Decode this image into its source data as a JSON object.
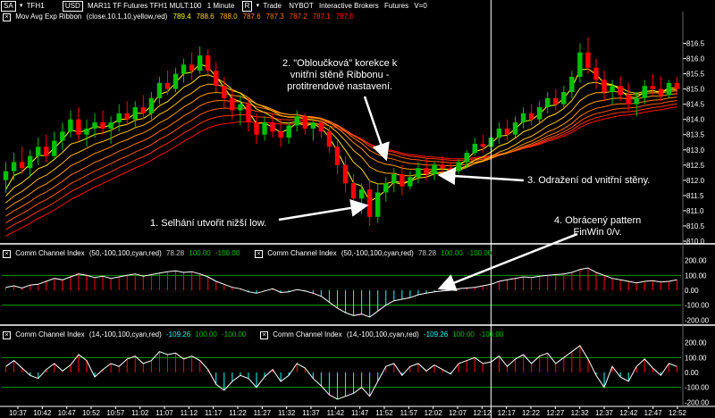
{
  "toolbar": {
    "symbol_box": "SA",
    "symbol": "TFH1",
    "instrument_box": "USD",
    "instrument": "MAR11 TF Futures TFH1 MULT:100",
    "interval": "1 Minute",
    "mode_box": "R",
    "trade": "Trade",
    "exchange": "NYBOT",
    "broker": "Interactive Brokers",
    "type": "Futures",
    "volume": "V=0"
  },
  "ribbon_legend": {
    "label": "Mov Avg Exp Ribbon",
    "params": "(close,10,1,10,yellow,red)",
    "values": [
      "789.4",
      "788.6",
      "788.0",
      "787.6",
      "787.3",
      "787.2",
      "787.1",
      "787.0"
    ],
    "colors": [
      "#ffff00",
      "#ffdd00",
      "#ffbb00",
      "#ff9900",
      "#ff7700",
      "#ff5500",
      "#ff3300",
      "#ff1100"
    ]
  },
  "cci1": {
    "label": "Comm Channel Index",
    "params": "(50,-100,100,cyan,red)",
    "value": "78.28",
    "upper": "100.00",
    "lower": "-100.00",
    "axis": [
      "200.00",
      "100.00",
      "0.00",
      "-100.00",
      "-200.00"
    ]
  },
  "cci2": {
    "label": "Comm Channel Index",
    "params": "(14,-100,100,cyan,red)",
    "value": "-109.26",
    "upper": "100.00",
    "lower": "-100.00",
    "axis": [
      "200.00",
      "100.00",
      "0.00",
      "-100.00",
      "-200.00"
    ]
  },
  "price_axis": [
    "816.5",
    "816.0",
    "815.5",
    "815.0",
    "814.5",
    "814.0",
    "813.5",
    "813.0",
    "812.5",
    "812.0",
    "811.5",
    "811.0",
    "810.5",
    "810.0"
  ],
  "time_axis": [
    "10:37",
    "10:42",
    "10:47",
    "10:52",
    "10:57",
    "11:02",
    "11:07",
    "11:12",
    "11:17",
    "11:22",
    "11:27",
    "11:32",
    "11:37",
    "11:42",
    "11:47",
    "11:52",
    "11:57",
    "12:02",
    "12:07",
    "12:12",
    "12:17",
    "12:22",
    "12:27",
    "12:32",
    "12:37",
    "12:42",
    "12:47",
    "12:52"
  ],
  "annotations": {
    "a1": "1. Selhání utvořit nižší low.",
    "a2": [
      "2. \"Obloučková\" korekce k",
      "vnitřní stěně Ribbonu -",
      "protitrendové nastavení."
    ],
    "a3": "3. Odražení od vnitřní stěny.",
    "a4": [
      "4. Obrácený pattern",
      "FinWin 0/v."
    ]
  },
  "colors": {
    "background": "#000000",
    "bull": "#00c000",
    "bear": "#ff0000",
    "cci_pos": "#ff0000",
    "cci_neg": "#00ffff",
    "level_line": "#00a000",
    "cursor": "#ffffff",
    "legend_value": "#00c000"
  },
  "chart_data": {
    "type": "candlestick",
    "ylim": [
      810.0,
      816.75
    ],
    "ohlc": [
      [
        812.0,
        812.6,
        811.6,
        812.3
      ],
      [
        812.3,
        812.9,
        812.0,
        812.6
      ],
      [
        812.6,
        813.1,
        812.2,
        812.4
      ],
      [
        812.4,
        813.0,
        812.1,
        812.8
      ],
      [
        812.8,
        813.4,
        812.5,
        813.1
      ],
      [
        813.1,
        813.5,
        812.6,
        812.8
      ],
      [
        812.8,
        813.6,
        812.7,
        813.3
      ],
      [
        813.3,
        813.9,
        813.0,
        813.6
      ],
      [
        813.6,
        814.3,
        813.4,
        814.0
      ],
      [
        814.0,
        814.4,
        813.3,
        813.5
      ],
      [
        813.5,
        814.0,
        813.1,
        813.7
      ],
      [
        813.7,
        814.2,
        813.4,
        813.9
      ],
      [
        813.9,
        814.3,
        813.5,
        813.7
      ],
      [
        813.7,
        814.1,
        813.2,
        813.9
      ],
      [
        813.9,
        814.5,
        813.6,
        814.2
      ],
      [
        814.2,
        814.6,
        813.8,
        814.0
      ],
      [
        814.0,
        814.6,
        813.7,
        814.4
      ],
      [
        814.4,
        814.8,
        814.0,
        814.2
      ],
      [
        814.2,
        814.9,
        814.0,
        814.7
      ],
      [
        814.7,
        815.4,
        814.5,
        815.2
      ],
      [
        815.2,
        815.6,
        814.8,
        815.0
      ],
      [
        815.0,
        815.7,
        814.9,
        815.5
      ],
      [
        815.5,
        816.0,
        815.2,
        815.8
      ],
      [
        815.8,
        816.2,
        815.3,
        815.6
      ],
      [
        815.6,
        816.4,
        815.5,
        816.1
      ],
      [
        816.1,
        816.3,
        815.4,
        815.6
      ],
      [
        815.6,
        815.9,
        814.9,
        815.1
      ],
      [
        815.1,
        815.4,
        814.4,
        814.7
      ],
      [
        814.7,
        815.0,
        814.0,
        814.3
      ],
      [
        814.3,
        814.8,
        813.8,
        814.5
      ],
      [
        814.5,
        814.7,
        813.6,
        813.9
      ],
      [
        813.9,
        814.2,
        813.2,
        813.5
      ],
      [
        813.5,
        814.1,
        813.3,
        813.9
      ],
      [
        813.9,
        814.2,
        813.4,
        813.6
      ],
      [
        813.6,
        814.0,
        813.1,
        813.4
      ],
      [
        813.4,
        813.9,
        813.2,
        813.8
      ],
      [
        813.8,
        814.3,
        813.6,
        814.1
      ],
      [
        814.1,
        814.2,
        813.5,
        813.7
      ],
      [
        813.7,
        814.0,
        813.3,
        813.9
      ],
      [
        813.9,
        814.0,
        813.4,
        813.6
      ],
      [
        813.6,
        813.8,
        812.9,
        813.1
      ],
      [
        813.1,
        813.3,
        812.2,
        812.5
      ],
      [
        812.5,
        812.8,
        811.6,
        811.9
      ],
      [
        811.9,
        812.2,
        811.2,
        811.4
      ],
      [
        811.4,
        811.9,
        810.9,
        811.7
      ],
      [
        811.7,
        812.0,
        810.5,
        810.8
      ],
      [
        810.8,
        811.9,
        810.6,
        811.6
      ],
      [
        811.6,
        812.1,
        811.3,
        811.9
      ],
      [
        811.9,
        812.4,
        811.6,
        812.2
      ],
      [
        812.2,
        812.5,
        811.5,
        811.8
      ],
      [
        811.8,
        812.3,
        811.7,
        812.1
      ],
      [
        812.1,
        812.6,
        811.9,
        812.4
      ],
      [
        812.4,
        812.7,
        812.0,
        812.2
      ],
      [
        812.2,
        812.6,
        812.0,
        812.5
      ],
      [
        812.5,
        812.8,
        812.2,
        812.4
      ],
      [
        812.4,
        812.6,
        812.1,
        812.3
      ],
      [
        812.3,
        812.7,
        812.2,
        812.6
      ],
      [
        812.6,
        813.0,
        812.4,
        812.9
      ],
      [
        812.9,
        813.4,
        812.8,
        813.2
      ],
      [
        813.2,
        813.5,
        812.9,
        813.1
      ],
      [
        813.1,
        813.6,
        813.0,
        813.4
      ],
      [
        813.4,
        813.9,
        813.2,
        813.7
      ],
      [
        813.7,
        814.0,
        813.3,
        813.5
      ],
      [
        813.5,
        814.1,
        813.4,
        813.9
      ],
      [
        813.9,
        814.4,
        813.7,
        814.2
      ],
      [
        814.2,
        814.5,
        813.8,
        814.0
      ],
      [
        814.0,
        814.6,
        813.9,
        814.4
      ],
      [
        814.4,
        814.9,
        814.2,
        814.7
      ],
      [
        814.7,
        815.0,
        814.3,
        814.5
      ],
      [
        814.5,
        815.1,
        814.4,
        814.9
      ],
      [
        814.9,
        815.6,
        814.7,
        815.4
      ],
      [
        815.4,
        816.5,
        815.2,
        816.2
      ],
      [
        816.2,
        816.7,
        815.5,
        815.7
      ],
      [
        815.7,
        816.0,
        815.0,
        815.3
      ],
      [
        815.3,
        815.6,
        814.6,
        814.9
      ],
      [
        814.9,
        815.3,
        814.5,
        815.1
      ],
      [
        815.1,
        815.4,
        814.6,
        814.8
      ],
      [
        814.8,
        815.2,
        814.3,
        814.5
      ],
      [
        814.5,
        814.9,
        814.1,
        814.7
      ],
      [
        814.7,
        815.3,
        814.5,
        815.1
      ],
      [
        815.1,
        815.5,
        814.8,
        815.0
      ],
      [
        815.0,
        815.4,
        814.6,
        814.8
      ],
      [
        814.8,
        815.3,
        814.7,
        815.2
      ],
      [
        815.2,
        815.4,
        814.8,
        815.0
      ]
    ],
    "ribbon": {
      "count": 8,
      "colors": [
        "#ffff00",
        "#ffdd00",
        "#ffbb00",
        "#ff9900",
        "#ff7700",
        "#ff5500",
        "#ff3300",
        "#ff1100"
      ]
    },
    "cursor_index": 60,
    "cci1_values": [
      20,
      30,
      15,
      35,
      40,
      60,
      80,
      70,
      90,
      110,
      100,
      85,
      95,
      80,
      90,
      100,
      110,
      95,
      105,
      115,
      125,
      130,
      120,
      125,
      110,
      90,
      60,
      40,
      20,
      10,
      -10,
      -20,
      -5,
      10,
      -15,
      -10,
      5,
      -5,
      -20,
      -40,
      -80,
      -120,
      -150,
      -170,
      -160,
      -180,
      -140,
      -100,
      -70,
      -60,
      -50,
      -30,
      -20,
      -10,
      -5,
      0,
      10,
      15,
      20,
      30,
      40,
      60,
      70,
      80,
      90,
      85,
      95,
      100,
      105,
      110,
      120,
      140,
      150,
      120,
      100,
      80,
      70,
      60,
      50,
      60,
      65,
      55,
      60,
      70
    ],
    "cci2_values": [
      40,
      80,
      30,
      -20,
      -40,
      20,
      60,
      10,
      50,
      120,
      80,
      -30,
      20,
      60,
      40,
      90,
      110,
      60,
      80,
      140,
      120,
      130,
      90,
      110,
      80,
      20,
      -80,
      -120,
      -60,
      -20,
      -40,
      -100,
      -30,
      20,
      -60,
      -20,
      60,
      30,
      -40,
      -90,
      -150,
      -180,
      -160,
      -140,
      -100,
      -160,
      -60,
      40,
      60,
      -20,
      40,
      60,
      10,
      50,
      20,
      -10,
      60,
      80,
      100,
      60,
      70,
      110,
      40,
      90,
      120,
      60,
      110,
      130,
      60,
      100,
      140,
      180,
      90,
      -20,
      -100,
      40,
      -30,
      -60,
      40,
      90,
      30,
      -20,
      60,
      40
    ]
  }
}
